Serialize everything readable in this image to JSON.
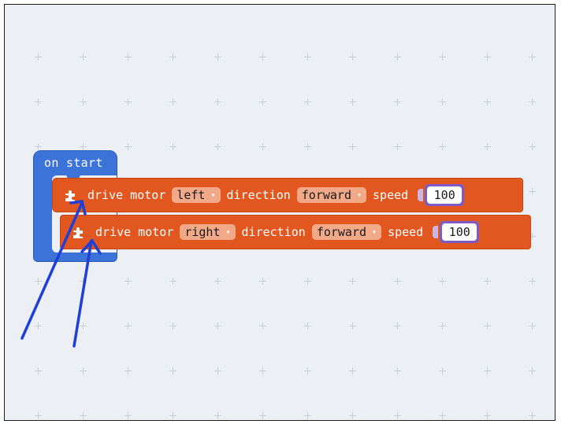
{
  "hat_block": {
    "label": "on start"
  },
  "blocks": [
    {
      "label_drive_motor": "drive motor",
      "motor": "left",
      "label_direction": "direction",
      "direction": "forward",
      "label_speed": "speed",
      "speed": "100"
    },
    {
      "label_drive_motor": "drive motor",
      "motor": "right",
      "label_direction": "direction",
      "direction": "forward",
      "label_speed": "speed",
      "speed": "100"
    }
  ],
  "dropdown_arrow": "▾",
  "colors": {
    "workspace_bg": "#ecf0f4",
    "hat_block": "#3b73d9",
    "motor_block": "#e2561f",
    "dropdown_bg": "#f2a988",
    "number_border": "#7c5cc4",
    "annotation_arrow": "#1f3fd6"
  },
  "icons": [
    "puzzle-piece-icon",
    "dropdown-arrow-icon",
    "annotation-arrow-icon"
  ]
}
